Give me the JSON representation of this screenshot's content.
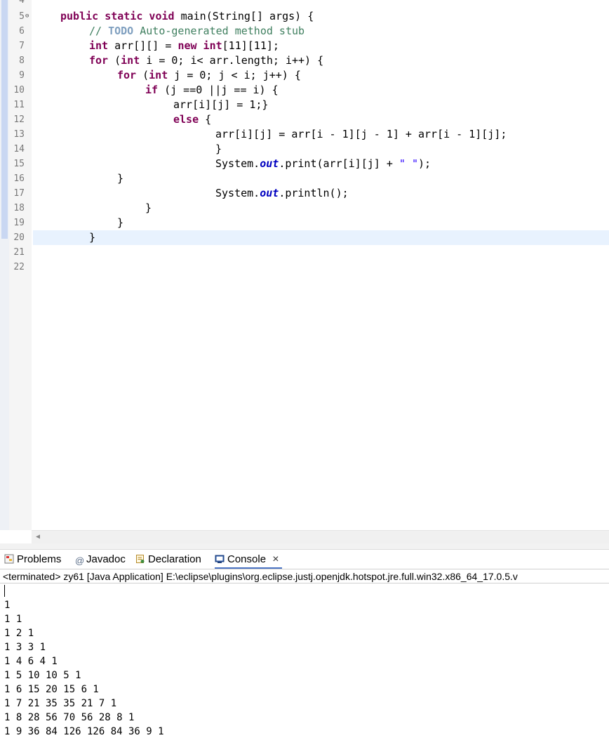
{
  "editor": {
    "line_numbers": [
      "4",
      "5",
      "6",
      "7",
      "8",
      "9",
      "10",
      "11",
      "12",
      "13",
      "14",
      "15",
      "16",
      "17",
      "18",
      "19",
      "20",
      "21",
      "22"
    ],
    "code": {
      "l5_kw": "public static void",
      "l5_rest": " main(String[] args) {",
      "l6_comment": "// ",
      "l6_todo": "TODO",
      "l6_rest": " Auto-generated method stub",
      "l7_kw1": "int",
      "l7_mid": " arr[][] = ",
      "l7_kw2": "new int",
      "l7_rest": "[11][11];",
      "l8_kw1": "for",
      "l8_mid": " (",
      "l8_kw2": "int",
      "l8_rest": " i = 0; i< arr.length; i++) {",
      "l9_kw1": "for",
      "l9_mid": " (",
      "l9_kw2": "int",
      "l9_rest": " j = 0; j < i; j++) {",
      "l10_kw": "if",
      "l10_rest": " (j ==0 ||j == i) {",
      "l11": "arr[i][j] = 1;}",
      "l12_kw": "else",
      "l12_rest": " {",
      "l13": "arr[i][j] = arr[i - 1][j - 1] + arr[i - 1][j];",
      "l14": "}",
      "l15_a": "System.",
      "l15_field": "out",
      "l15_b": ".print(arr[i][j] + ",
      "l15_str": "\" \"",
      "l15_c": ");",
      "l16": "}",
      "l17_a": "System.",
      "l17_field": "out",
      "l17_b": ".println();",
      "l18": "}",
      "l19": "}",
      "l20": "}"
    }
  },
  "tabs": {
    "problems": "Problems",
    "javadoc": "Javadoc",
    "declaration": "Declaration",
    "console": "Console",
    "close_glyph": "×"
  },
  "console": {
    "status": "<terminated> zy61 [Java Application] E:\\eclipse\\plugins\\org.eclipse.justj.openjdk.hotspot.jre.full.win32.x86_64_17.0.5.v",
    "output": [
      "1",
      "1 1",
      "1 2 1",
      "1 3 3 1",
      "1 4 6 4 1",
      "1 5 10 10 5 1",
      "1 6 15 20 15 6 1",
      "1 7 21 35 35 21 7 1",
      "1 8 28 56 70 56 28 8 1",
      "1 9 36 84 126 126 84 36 9 1"
    ]
  },
  "colors": {
    "keyword": "#7f0055",
    "comment": "#3f7f5f",
    "string": "#2a00ff",
    "field": "#0000c0",
    "current_line": "#e8f2fe",
    "console_tab_underline": "#4b74c4"
  }
}
